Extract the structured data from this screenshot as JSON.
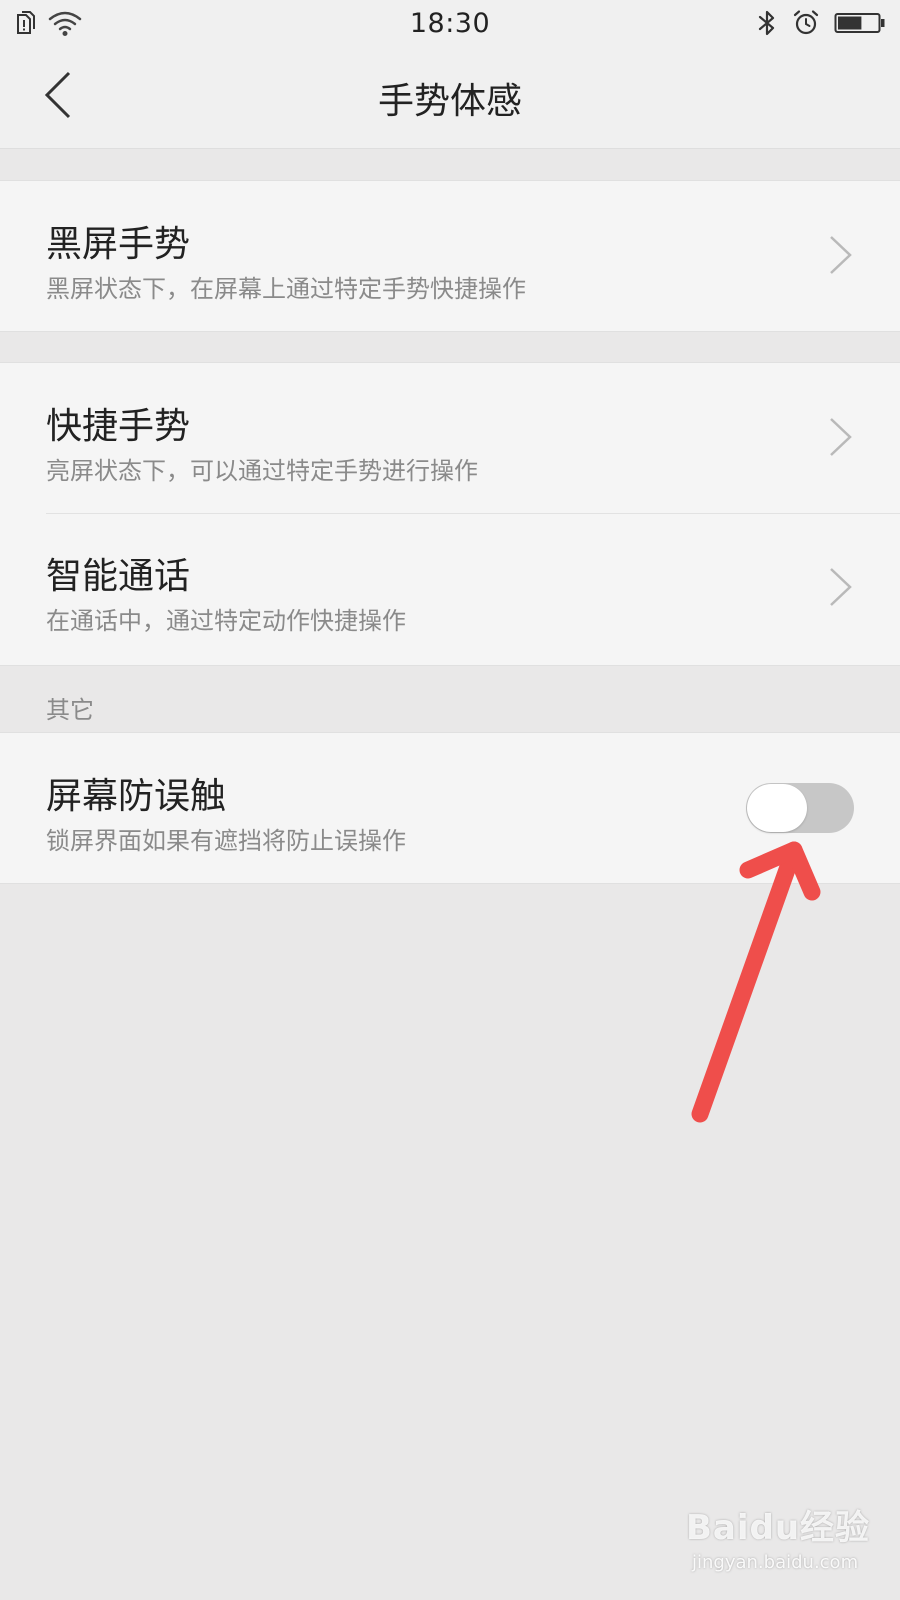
{
  "status_bar": {
    "time": "18:30",
    "left_icons": [
      "sim-alert-icon",
      "wifi-icon"
    ],
    "right_icons": [
      "bluetooth-icon",
      "alarm-icon",
      "battery-icon"
    ],
    "battery_level": 0.6
  },
  "header": {
    "title": "手势体感"
  },
  "sections": [
    {
      "items": [
        {
          "title": "黑屏手势",
          "subtitle": "黑屏状态下，在屏幕上通过特定手势快捷操作"
        }
      ]
    },
    {
      "items": [
        {
          "title": "快捷手势",
          "subtitle": "亮屏状态下，可以通过特定手势进行操作"
        },
        {
          "title": "智能通话",
          "subtitle": "在通话中，通过特定动作快捷操作"
        }
      ]
    },
    {
      "label": "其它",
      "items": [
        {
          "title": "屏幕防误触",
          "subtitle": "锁屏界面如果有遮挡将防止误操作",
          "toggle": false
        }
      ]
    }
  ],
  "annotation": {
    "color": "#ef4e4b",
    "icon": "red-arrow-icon"
  },
  "watermark": {
    "brand": "Baidu经验",
    "domain": "jingyan.baidu.com"
  },
  "colors": {
    "background": "#e9e8e8",
    "card": "#f5f5f5",
    "title_text": "#222222",
    "subtitle_text": "#8a8a8a",
    "toggle_off_track": "#c7c7c7"
  }
}
